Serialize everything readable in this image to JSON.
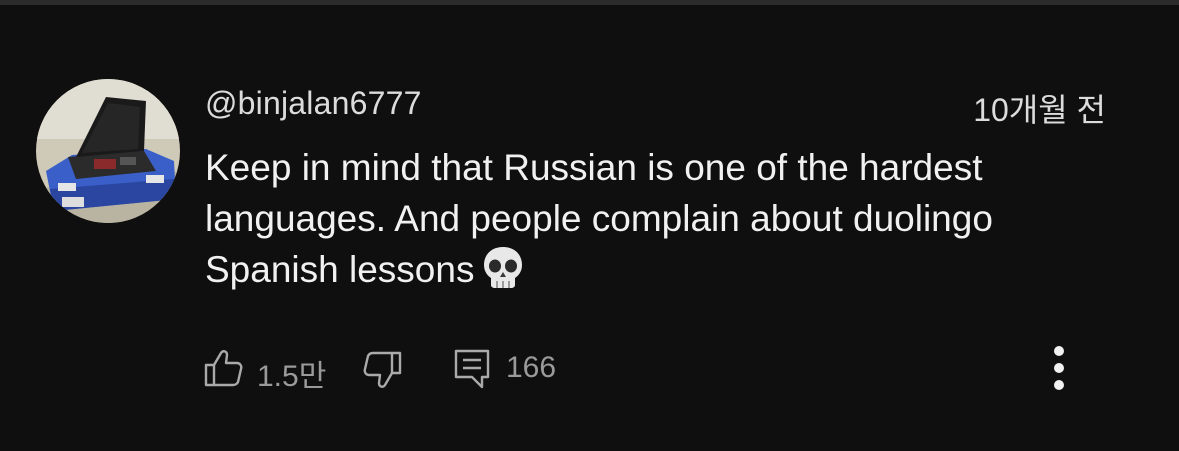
{
  "comment": {
    "author": "@binjalan6777",
    "timestamp": "10개월 전",
    "text": "Keep in mind that Russian is one of the hardest languages. And people complain about duolingo Spanish lessons",
    "emoji": "skull-emoji",
    "likes": "1.5만",
    "replies": "166"
  },
  "icons": {
    "like": "thumbs-up-icon",
    "dislike": "thumbs-down-icon",
    "reply": "comment-icon",
    "more": "more-vert-icon"
  },
  "colors": {
    "background": "#0f0f0f",
    "text": "#f1f1f1",
    "secondary_text": "#9a9a9a",
    "avatar_car": "#3a5fc8"
  }
}
